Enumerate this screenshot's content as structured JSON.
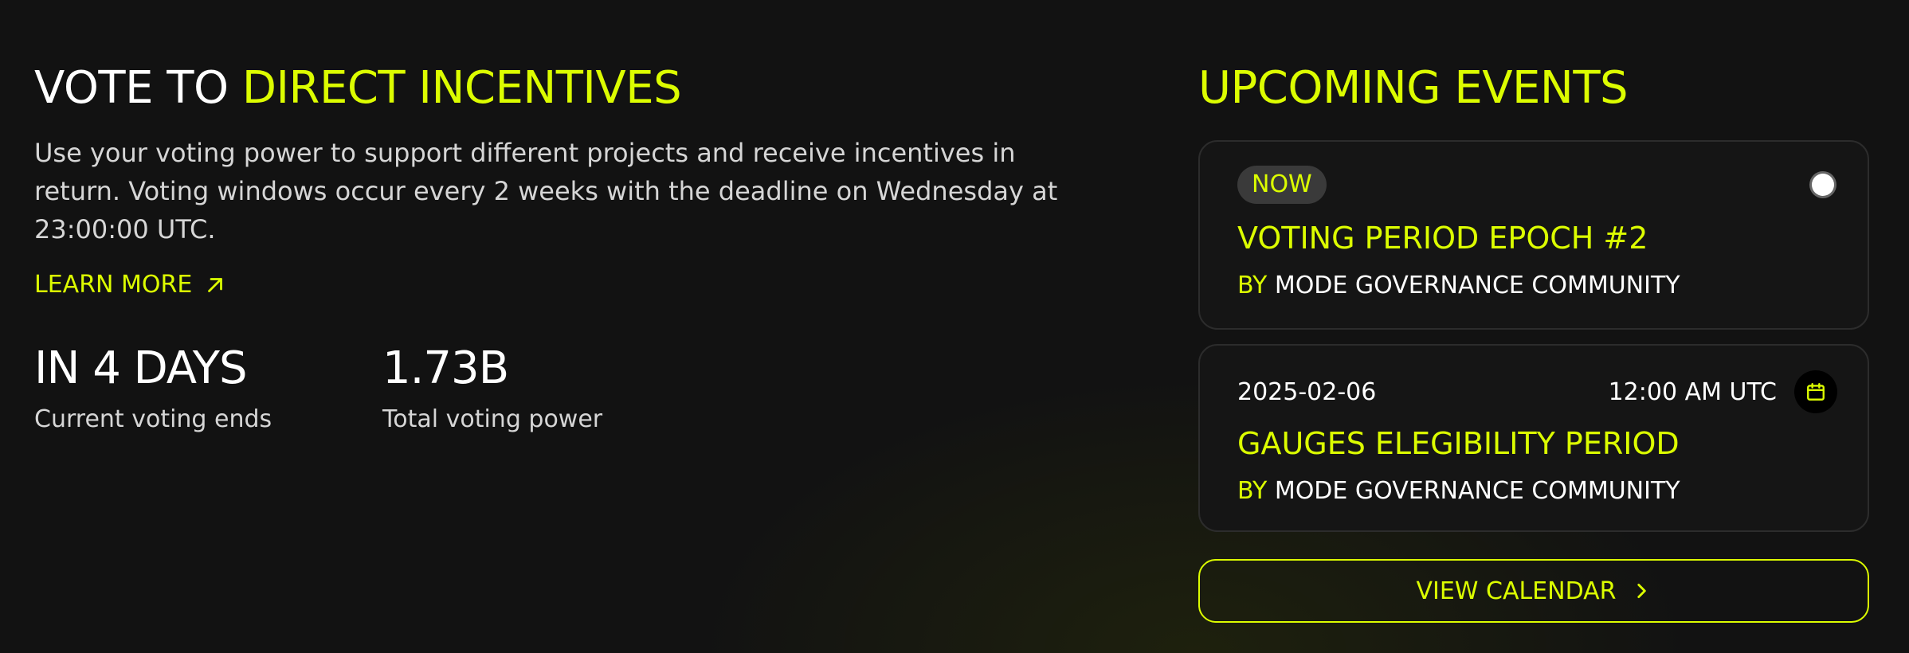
{
  "left": {
    "heading_prefix": "VOTE TO ",
    "heading_accent": "DIRECT INCENTIVES",
    "description": "Use your voting power to support different projects and receive incentives in return. Voting windows occur every 2 weeks with the deadline on Wednesday at 23:00:00 UTC.",
    "learn_more_label": "LEARN MORE",
    "stats": [
      {
        "value": "IN 4 DAYS",
        "label": "Current voting ends"
      },
      {
        "value": "1.73B",
        "label": "Total voting power"
      }
    ]
  },
  "right": {
    "title": "UPCOMING EVENTS",
    "events": [
      {
        "badge": "NOW",
        "title": "VOTING PERIOD EPOCH #2",
        "by_label": "BY",
        "by_name": "MODE GOVERNANCE COMMUNITY"
      },
      {
        "date": "2025-02-06",
        "time": "12:00 AM UTC",
        "title": "GAUGES ELEGIBILITY PERIOD",
        "by_label": "BY",
        "by_name": "MODE GOVERNANCE COMMUNITY"
      }
    ],
    "view_calendar_label": "VIEW CALENDAR"
  },
  "colors": {
    "accent": "#dcfd00",
    "background": "#121212",
    "card_border": "#2c2c2c"
  },
  "icons": {
    "learn_more": "arrow-up-right-icon",
    "calendar": "calendar-icon",
    "view_calendar": "chevron-right-icon"
  }
}
